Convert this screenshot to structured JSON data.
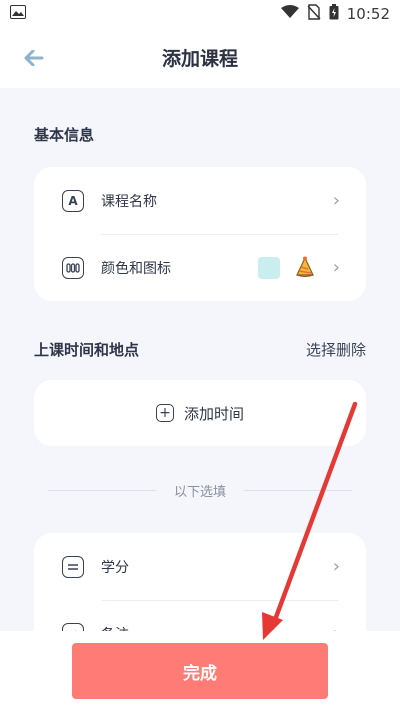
{
  "status": {
    "time": "10:52"
  },
  "header": {
    "title": "添加课程"
  },
  "basic": {
    "section_label": "基本信息",
    "rows": [
      {
        "label": "课程名称",
        "icon": "A"
      },
      {
        "label": "颜色和图标"
      }
    ],
    "swatch_color": "#c8eef0"
  },
  "schedule": {
    "section_label": "上课时间和地点",
    "delete_label": "选择删除",
    "add_time_label": "添加时间"
  },
  "optional": {
    "divider_label": "以下选填",
    "rows": [
      {
        "label": "学分"
      },
      {
        "label": "备注"
      }
    ]
  },
  "footer": {
    "done_label": "完成"
  },
  "colors": {
    "accent": "#ff7b75",
    "arrow": "#e53935"
  }
}
